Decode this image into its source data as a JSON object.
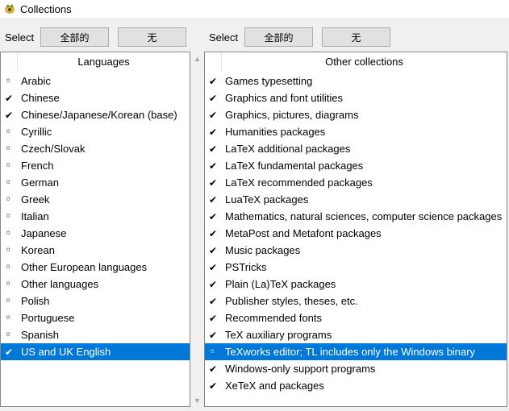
{
  "window": {
    "title": "Collections"
  },
  "left_toolbar": {
    "select_label": "Select",
    "all_label": "全部的",
    "none_label": "无"
  },
  "right_toolbar": {
    "select_label": "Select",
    "all_label": "全部的",
    "none_label": "无"
  },
  "languages": {
    "header": "Languages",
    "items": [
      {
        "label": "Arabic",
        "checked": false,
        "selected": false
      },
      {
        "label": "Chinese",
        "checked": true,
        "selected": false
      },
      {
        "label": "Chinese/Japanese/Korean (base)",
        "checked": true,
        "selected": false
      },
      {
        "label": "Cyrillic",
        "checked": false,
        "selected": false
      },
      {
        "label": "Czech/Slovak",
        "checked": false,
        "selected": false
      },
      {
        "label": "French",
        "checked": false,
        "selected": false
      },
      {
        "label": "German",
        "checked": false,
        "selected": false
      },
      {
        "label": "Greek",
        "checked": false,
        "selected": false
      },
      {
        "label": "Italian",
        "checked": false,
        "selected": false
      },
      {
        "label": "Japanese",
        "checked": false,
        "selected": false
      },
      {
        "label": "Korean",
        "checked": false,
        "selected": false
      },
      {
        "label": "Other European languages",
        "checked": false,
        "selected": false
      },
      {
        "label": "Other languages",
        "checked": false,
        "selected": false
      },
      {
        "label": "Polish",
        "checked": false,
        "selected": false
      },
      {
        "label": "Portuguese",
        "checked": false,
        "selected": false
      },
      {
        "label": "Spanish",
        "checked": false,
        "selected": false
      },
      {
        "label": "US and UK English",
        "checked": true,
        "selected": true
      }
    ]
  },
  "other_collections": {
    "header": "Other collections",
    "items": [
      {
        "label": "Games typesetting",
        "checked": true,
        "selected": false
      },
      {
        "label": "Graphics and font utilities",
        "checked": true,
        "selected": false
      },
      {
        "label": "Graphics, pictures, diagrams",
        "checked": true,
        "selected": false
      },
      {
        "label": "Humanities packages",
        "checked": true,
        "selected": false
      },
      {
        "label": "LaTeX additional packages",
        "checked": true,
        "selected": false
      },
      {
        "label": "LaTeX fundamental packages",
        "checked": true,
        "selected": false
      },
      {
        "label": "LaTeX recommended packages",
        "checked": true,
        "selected": false
      },
      {
        "label": "LuaTeX packages",
        "checked": true,
        "selected": false
      },
      {
        "label": "Mathematics, natural sciences, computer science packages",
        "checked": true,
        "selected": false
      },
      {
        "label": "MetaPost and Metafont packages",
        "checked": true,
        "selected": false
      },
      {
        "label": "Music packages",
        "checked": true,
        "selected": false
      },
      {
        "label": "PSTricks",
        "checked": true,
        "selected": false
      },
      {
        "label": "Plain (La)TeX packages",
        "checked": true,
        "selected": false
      },
      {
        "label": "Publisher styles, theses, etc.",
        "checked": true,
        "selected": false
      },
      {
        "label": "Recommended fonts",
        "checked": true,
        "selected": false
      },
      {
        "label": "TeX auxiliary programs",
        "checked": true,
        "selected": false
      },
      {
        "label": "TeXworks editor; TL includes only the Windows binary",
        "checked": false,
        "selected": true
      },
      {
        "label": "Windows-only support programs",
        "checked": true,
        "selected": false
      },
      {
        "label": "XeTeX and packages",
        "checked": true,
        "selected": false
      }
    ]
  },
  "icons": {
    "app": "tex-live-app-icon",
    "scroll_up": "scroll-up-arrow-icon",
    "scroll_down": "scroll-down-arrow-icon"
  }
}
